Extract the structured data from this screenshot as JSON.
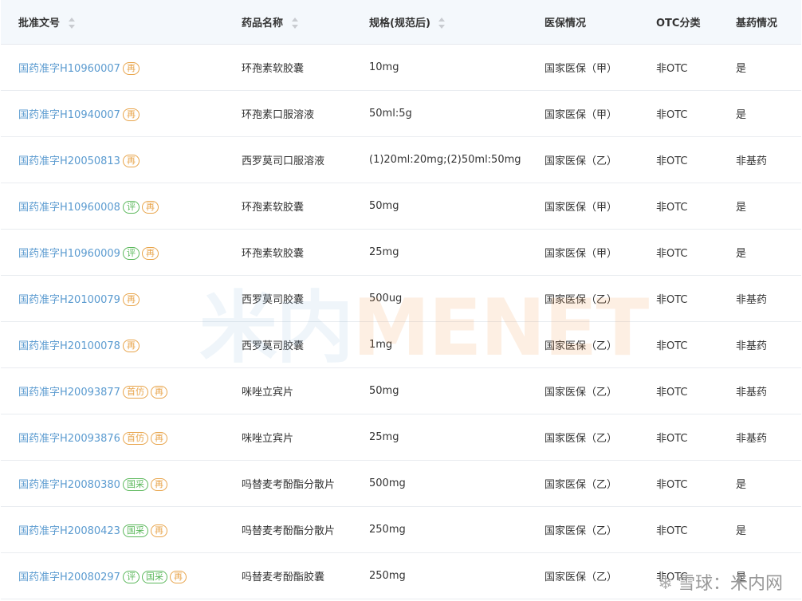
{
  "table": {
    "headers": [
      {
        "label": "批准文号",
        "sortable": true
      },
      {
        "label": "药品名称",
        "sortable": true
      },
      {
        "label": "规格(规范后)",
        "sortable": true
      },
      {
        "label": "医保情况",
        "sortable": false
      },
      {
        "label": "OTC分类",
        "sortable": false
      },
      {
        "label": "基药情况",
        "sortable": false
      }
    ],
    "rows": [
      {
        "number": "国药准字H10960007",
        "tags": [
          "再"
        ],
        "name": "环孢素软胶囊",
        "spec": "10mg",
        "insurance": "国家医保（甲）",
        "otc": "非OTC",
        "essential": "是"
      },
      {
        "number": "国药准字H10940007",
        "tags": [
          "再"
        ],
        "name": "环孢素口服溶液",
        "spec": "50ml:5g",
        "insurance": "国家医保（甲）",
        "otc": "非OTC",
        "essential": "是"
      },
      {
        "number": "国药准字H20050813",
        "tags": [
          "再"
        ],
        "name": "西罗莫司口服溶液",
        "spec": "(1)20ml:20mg;(2)50ml:50mg",
        "insurance": "国家医保（乙）",
        "otc": "非OTC",
        "essential": "非基药"
      },
      {
        "number": "国药准字H10960008",
        "tags": [
          "评",
          "再"
        ],
        "name": "环孢素软胶囊",
        "spec": "50mg",
        "insurance": "国家医保（甲）",
        "otc": "非OTC",
        "essential": "是"
      },
      {
        "number": "国药准字H10960009",
        "tags": [
          "评",
          "再"
        ],
        "name": "环孢素软胶囊",
        "spec": "25mg",
        "insurance": "国家医保（甲）",
        "otc": "非OTC",
        "essential": "是"
      },
      {
        "number": "国药准字H20100079",
        "tags": [
          "再"
        ],
        "name": "西罗莫司胶囊",
        "spec": "500ug",
        "insurance": "国家医保（乙）",
        "otc": "非OTC",
        "essential": "非基药"
      },
      {
        "number": "国药准字H20100078",
        "tags": [
          "再"
        ],
        "name": "西罗莫司胶囊",
        "spec": "1mg",
        "insurance": "国家医保（乙）",
        "otc": "非OTC",
        "essential": "非基药"
      },
      {
        "number": "国药准字H20093877",
        "tags": [
          "首仿",
          "再"
        ],
        "name": "咪唑立宾片",
        "spec": "50mg",
        "insurance": "国家医保（乙）",
        "otc": "非OTC",
        "essential": "非基药"
      },
      {
        "number": "国药准字H20093876",
        "tags": [
          "首仿",
          "再"
        ],
        "name": "咪唑立宾片",
        "spec": "25mg",
        "insurance": "国家医保（乙）",
        "otc": "非OTC",
        "essential": "非基药"
      },
      {
        "number": "国药准字H20080380",
        "tags": [
          "国采",
          "再"
        ],
        "name": "吗替麦考酚酯分散片",
        "spec": "500mg",
        "insurance": "国家医保（乙）",
        "otc": "非OTC",
        "essential": "是"
      },
      {
        "number": "国药准字H20080423",
        "tags": [
          "国采",
          "再"
        ],
        "name": "吗替麦考酚酯分散片",
        "spec": "250mg",
        "insurance": "国家医保（乙）",
        "otc": "非OTC",
        "essential": "是"
      },
      {
        "number": "国药准字H20080297",
        "tags": [
          "评",
          "国采",
          "再"
        ],
        "name": "吗替麦考酚酯胶囊",
        "spec": "250mg",
        "insurance": "国家医保（乙）",
        "otc": "非OTC",
        "essential": "是"
      }
    ]
  },
  "watermark": {
    "cn": "米内",
    "en": "MENET"
  },
  "corner_watermark": {
    "text": "雪球：米内网"
  },
  "tag_colors": {
    "再": "#e8a44a",
    "首仿": "#e8a44a",
    "评": "#5cb85c",
    "国采": "#5cb85c"
  }
}
